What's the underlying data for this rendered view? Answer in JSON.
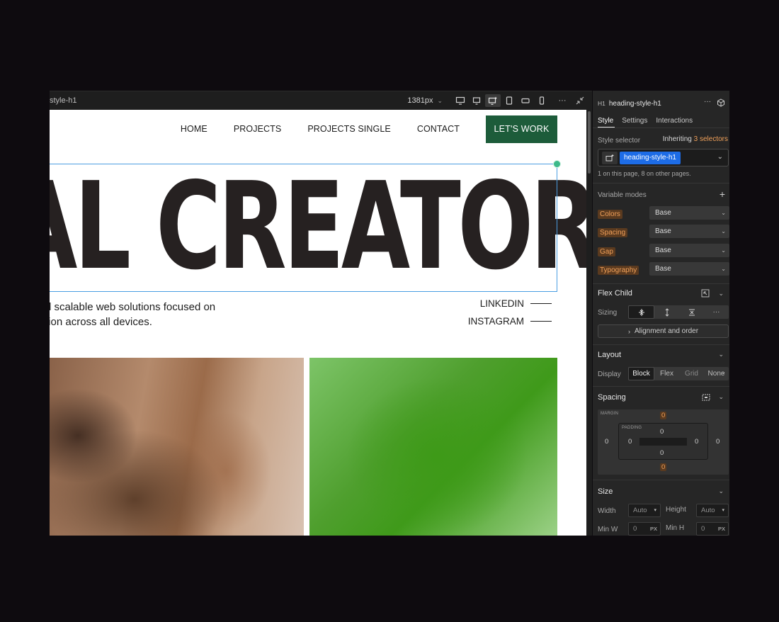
{
  "canvas": {
    "breadcrumb": "style-h1",
    "width_label": "1381px",
    "breakpoint_icons": [
      "desktop-large-icon",
      "desktop-icon",
      "desktop-base-icon",
      "tablet-icon",
      "mobile-landscape-icon",
      "mobile-portrait-icon"
    ],
    "more": "···"
  },
  "site": {
    "nav": [
      "HOME",
      "PROJECTS",
      "PROJECTS SINGLE",
      "CONTACT"
    ],
    "cta": "LET'S WORK",
    "heading": "AL CREATOR",
    "subcopy_line1": "d scalable web solutions focused on",
    "subcopy_line2": "tion across all devices.",
    "social": [
      "LINKEDIN",
      "INSTAGRAM"
    ]
  },
  "panel": {
    "element_tag": "H1",
    "element_name": "heading-style-h1",
    "tabs": [
      "Style",
      "Settings",
      "Interactions"
    ],
    "style_selector_label": "Style selector",
    "inheriting_prefix": "Inheriting",
    "inheriting_count": "3 selectors",
    "selector_chip": "heading-style-h1",
    "usage_note": "1 on this page, 8 on other pages.",
    "variable_modes_title": "Variable modes",
    "modes": [
      {
        "label": "Colors",
        "value": "Base"
      },
      {
        "label": "Spacing",
        "value": "Base"
      },
      {
        "label": "Gap",
        "value": "Base"
      },
      {
        "label": "Typography",
        "value": "Base"
      }
    ],
    "flex_child_title": "Flex Child",
    "sizing_label": "Sizing",
    "alignment_button": "Alignment and order",
    "layout_title": "Layout",
    "display_label": "Display",
    "display_options": [
      "Block",
      "Flex",
      "Grid",
      "None"
    ],
    "spacing_title": "Spacing",
    "margin_label": "MARGIN",
    "padding_label": "PADDING",
    "margin": {
      "top": "0",
      "right": "0",
      "bottom": "0",
      "left": "0"
    },
    "padding": {
      "top": "0",
      "right": "0",
      "bottom": "0",
      "left": "0"
    },
    "size_title": "Size",
    "width_label": "Width",
    "width_value": "Auto",
    "height_label": "Height",
    "height_value": "Auto",
    "min_w_label": "Min W",
    "min_w_value": "0",
    "min_h_label": "Min H",
    "min_h_value": "0",
    "unit": "PX",
    "accent_orange": "#f0a05a",
    "accent_blue": "#1d6ce6"
  }
}
